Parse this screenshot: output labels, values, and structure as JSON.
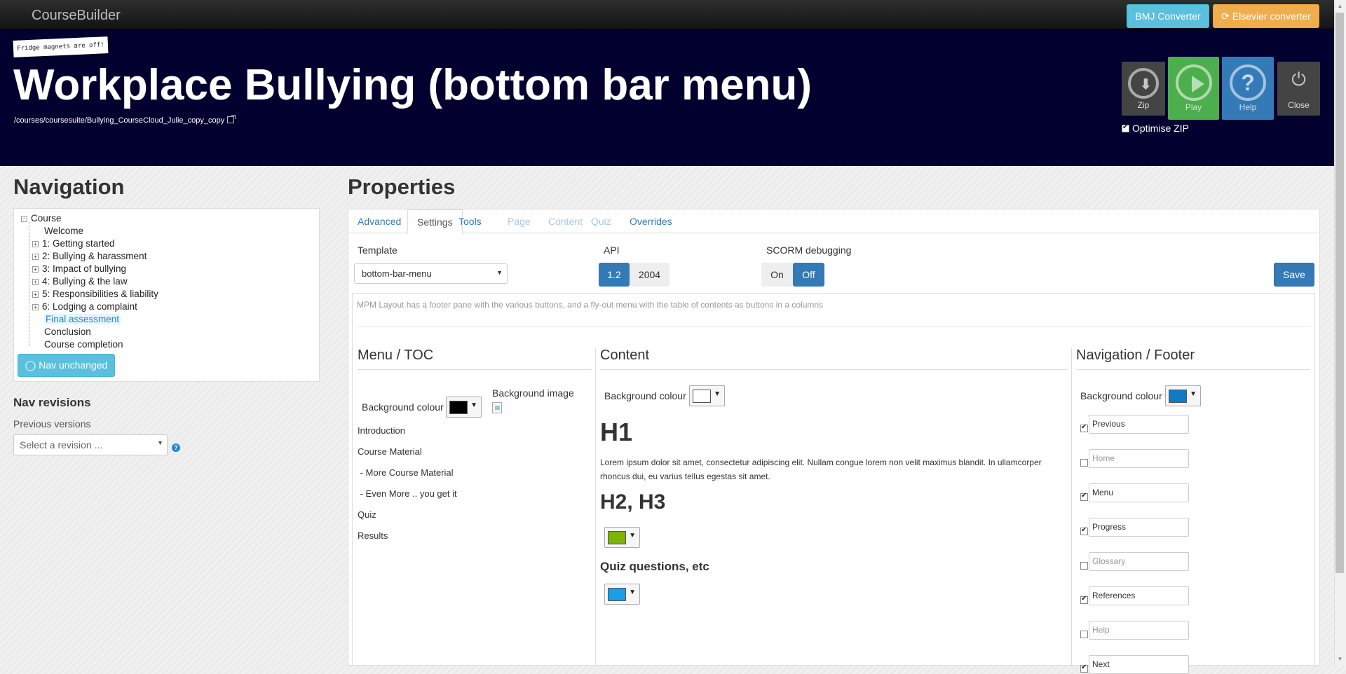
{
  "app": {
    "brand": "CourseBuilder"
  },
  "topbar": {
    "bmj_label": "BMJ Converter",
    "elsevier_label": "Elsevier converter"
  },
  "hero": {
    "sticker": "Fridge magnets are off!",
    "title": "Workplace Bullying (bottom bar menu)",
    "path": "/courses/coursesuite/Bullying_CourseCloud_Julie_copy_copy",
    "tiles": {
      "zip": "Zip",
      "play": "Play",
      "help": "Help",
      "close": "Close"
    },
    "optimise_zip": "Optimise ZIP",
    "optimise_zip_checked": true
  },
  "navigation": {
    "heading": "Navigation",
    "tree": {
      "root": "Course",
      "items": [
        {
          "label": "Welcome",
          "expandable": false
        },
        {
          "label": "1: Getting started",
          "expandable": true
        },
        {
          "label": "2: Bullying & harassment",
          "expandable": true
        },
        {
          "label": "3: Impact of bullying",
          "expandable": true
        },
        {
          "label": "4: Bullying & the law",
          "expandable": true
        },
        {
          "label": "5: Responsibilities & liability",
          "expandable": true
        },
        {
          "label": "6: Lodging a complaint",
          "expandable": true
        },
        {
          "label": "Final assessment",
          "expandable": false,
          "selected": true
        },
        {
          "label": "Conclusion",
          "expandable": false
        },
        {
          "label": "Course completion",
          "expandable": false
        }
      ]
    },
    "nav_button": "Nav unchanged",
    "revisions_heading": "Nav revisions",
    "previous_versions_label": "Previous versions",
    "revision_select": "Select a revision ..."
  },
  "properties": {
    "heading": "Properties",
    "tabs": [
      {
        "label": "Advanced",
        "state": "normal"
      },
      {
        "label": "Settings",
        "state": "active"
      },
      {
        "label": "Tools",
        "state": "normal"
      },
      {
        "label": "Page",
        "state": "disabled"
      },
      {
        "label": "Content",
        "state": "disabled"
      },
      {
        "label": "Quiz",
        "state": "disabled"
      },
      {
        "label": "Overrides",
        "state": "normal"
      }
    ],
    "template_label": "Template",
    "template_value": "bottom-bar-menu",
    "api_label": "API",
    "api_options": [
      "1.2",
      "2004"
    ],
    "api_selected": "1.2",
    "scorm_label": "SCORM debugging",
    "scorm_options": [
      "On",
      "Off"
    ],
    "scorm_selected": "Off",
    "save_label": "Save",
    "description": "MPM Layout has a footer pane with the various buttons, and a fly-out menu with the table of contents as buttons in a columns",
    "menu_toc": {
      "heading": "Menu / TOC",
      "bg_label": "Background colour",
      "bg_color": "#000000",
      "bg_image_label": "Background image",
      "items": [
        "Introduction",
        "Course Material",
        " - More Course Material",
        " - Even More .. you get it",
        "Quiz",
        "Results"
      ]
    },
    "content": {
      "heading": "Content",
      "bg_label": "Background colour",
      "bg_color": "#ffffff",
      "h1": "H1",
      "lorem": "Lorem ipsum dolor sit amet, consectetur adipiscing elit. Nullam congue lorem non velit maximus blandit. In ullamcorper rhoncus dui, eu varius tellus egestas sit amet.",
      "h2h3": "H2, H3",
      "h2h3_color": "#7cb305",
      "quiz_label": "Quiz questions, etc",
      "quiz_color": "#1a9fe6"
    },
    "nav_footer": {
      "heading": "Navigation / Footer",
      "bg_label": "Background colour",
      "bg_color": "#1279c4",
      "items": [
        {
          "label": "Previous",
          "checked": true
        },
        {
          "label": "Home",
          "checked": false
        },
        {
          "label": "Menu",
          "checked": true
        },
        {
          "label": "Progress",
          "checked": true
        },
        {
          "label": "Glossary",
          "checked": false
        },
        {
          "label": "References",
          "checked": true
        },
        {
          "label": "Help",
          "checked": false
        },
        {
          "label": "Next",
          "checked": true
        }
      ]
    }
  }
}
